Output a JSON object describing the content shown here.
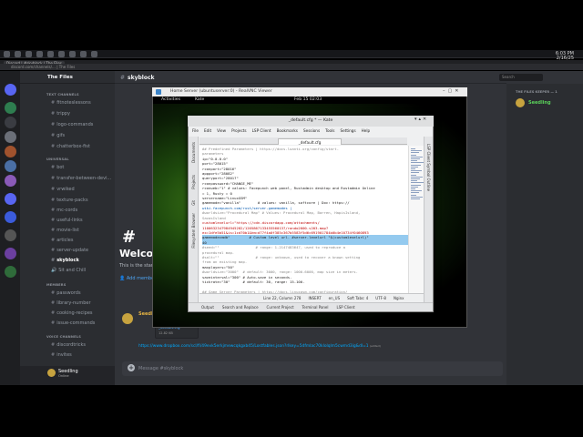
{
  "clock": {
    "time": "6:03 PM",
    "date": "2/16/25"
  },
  "browser": {
    "tabs": [
      "Discord | #skyblock | The Files"
    ],
    "address": "discord.com/channels/… | The Files"
  },
  "discord": {
    "server_name": "The Files",
    "channel_header": "skyblock",
    "search_placeholder": "Search",
    "categories": [
      "TEXT CHANNELS",
      "UNIVERSAL",
      "MEMBERS",
      "VOICE CHANNELS"
    ],
    "channels_group1": [
      "fitnoteslessons",
      "trippy",
      "logo-commands",
      "gifs",
      "chatterbox-fist"
    ],
    "channels_group2": [
      "bot",
      "transfer-between-devi...",
      "vrwiked",
      "texture-packs",
      "mc-cords",
      "useful-links",
      "movie-list",
      "articles",
      "server-update",
      "skyblock",
      "Sit and Chill"
    ],
    "channels_group3": [
      "passwords",
      "library-number",
      "cooking-recipes",
      "issue-commands"
    ],
    "channels_group4": [
      "discordtricks",
      "invites"
    ],
    "selected_channel": "skyblock",
    "user": {
      "name": "Seedling",
      "status": "Online"
    },
    "members_header": "THE FILES KEEPER — 1",
    "member_name": "Seedling",
    "welcome_hash": "#",
    "welcome_title": "Welcome",
    "welcome_sub": "This is the start",
    "add_members": "Add member",
    "message_author": "Seedlin",
    "attachment_name": "_default.cfg",
    "attachment_size": "12.82 KB",
    "link": "https://www.dropbox.com/scl/fi/49evk5erkjmewcqkgxb45/Lostfables.json?rlkey=5dfmlac70klolqlm5cwmd3ig&dl=1",
    "edited": "(edited)",
    "message_placeholder": "Message #skyblock"
  },
  "vnc": {
    "title": "Home Server (ubuntuserver:0) - RealVNC Viewer",
    "gnome_activities": "Activities",
    "gnome_app": "Kate",
    "gnome_clock": "Feb 15 02:03"
  },
  "kate": {
    "title": "_default.cfg * — Kate",
    "menu": [
      "File",
      "Edit",
      "View",
      "Projects",
      "LSP Client",
      "Bookmarks",
      "Sessions",
      "Tools",
      "Settings",
      "Help"
    ],
    "tab": "_default.cfg",
    "left_tabs": [
      "Documents",
      "Projects",
      "Git",
      "Filesystem Browser"
    ],
    "right_tabs": [
      "LSP Client Symbol Outline"
    ],
    "code_lines": [
      {
        "t": "## Predefined Parameters | https://docs.luanti.org/config/start-",
        "c": "cm"
      },
      {
        "t": "parameters",
        "c": "cm"
      },
      {
        "t": "ip=\"0.0.0.0\"",
        "c": ""
      },
      {
        "t": "port=\"28015\"",
        "c": ""
      },
      {
        "t": "rconport=\"28016\"",
        "c": ""
      },
      {
        "t": "appport=\"28082\"",
        "c": ""
      },
      {
        "t": "queryport=\"28017\"",
        "c": ""
      },
      {
        "t": "rconpassword=\"CHANGE_ME\"",
        "c": ""
      },
      {
        "t": "rconweb=\"1\" # values: Facepunch web panel, Rustadmin desktop and Rustadmin Online",
        "c": ""
      },
      {
        "t": "= 1, Rusty = 0",
        "c": ""
      },
      {
        "t": "servername=\"LinuxGSM\"",
        "c": ""
      },
      {
        "t": "gamemode=\"vanilla\"        # values: vanilla, softcore | Doc: https://",
        "c": ""
      },
      {
        "t": "wiki.facepunch.com/rust/server-gamemodes |",
        "c": "kw"
      },
      {
        "t": "#worldsize=\"Procedural Map\" # Values: Procedural Map, Barren, HapisIsland,",
        "c": "cm"
      },
      {
        "t": "SavasIsland",
        "c": "cm"
      },
      {
        "t": "customlevelurl=\"https://cdn.discordapp.com/attachments/",
        "c": "str"
      },
      {
        "t": "1100632347984945282/1205867133455560137/rando2000.v203.map?",
        "c": "str"
      },
      {
        "t": "ex=1dfe5b51&is=1cd70b1&hm=d77f4a0f385c367b5583f5d6c691901784b0b4e10734f0460893",
        "c": "str"
      },
      {
        "t": "gamemodecmdb\"         # Custom level url. #server.levelurl \"$(customlevelurl)\"",
        "c": "",
        "hl": true
      },
      {
        "t": "40",
        "c": "",
        "hl": true
      },
      {
        "t": "#seed=\"\"                 # range: 1-2147483647, used to reproduce a",
        "c": "cm"
      },
      {
        "t": "procedural map.",
        "c": "cm"
      },
      {
        "t": "#salt=\"\"                 # range: unknown, used to recover a known setting",
        "c": "cm"
      },
      {
        "t": "from an existing map.",
        "c": "cm"
      },
      {
        "t": "maxplayers=\"50\"",
        "c": ""
      },
      {
        "t": "#worldsize=\"3000\"  # default: 3000, range: 1000-6000, map size in meters.",
        "c": "cm"
      },
      {
        "t": "saveinterval=\"300\" # Auto-save in seconds.",
        "c": ""
      },
      {
        "t": "tickrate=\"30\"      # default: 30, range: 15-100.",
        "c": ""
      },
      {
        "t": "",
        "c": ""
      },
      {
        "t": "## Game Server Parameters | https://docs.linuxgsm.com/configuration/",
        "c": "cm"
      }
    ],
    "status": [
      "Line 22, Column 278",
      "INSERT",
      "en_US",
      "Soft Tabs: 4",
      "UTF-8",
      "Nginx"
    ],
    "bottom_tabs": [
      "Output",
      "Search and Replace",
      "Current Project",
      "Terminal Panel",
      "LSP Client"
    ]
  }
}
